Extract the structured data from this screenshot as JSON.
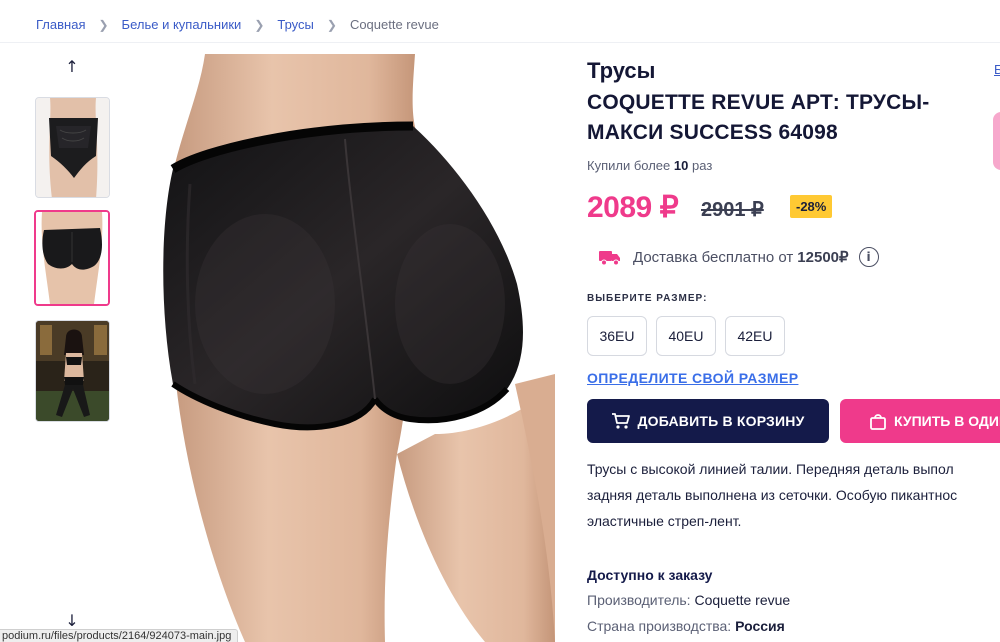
{
  "breadcrumb": {
    "items": [
      "Главная",
      "Белье и купальники",
      "Трусы"
    ],
    "current": "Coquette revue"
  },
  "product": {
    "title_line1": "Трусы",
    "title_line2": "COQUETTE REVUE АРТ: ТРУСЫ-МАКСИ SUCCESS 64098",
    "bought_prefix": "Купили более",
    "bought_count": "10",
    "bought_suffix": "раз",
    "price": "2089 ₽",
    "old_price": "2901 ₽",
    "discount": "-28%"
  },
  "delivery": {
    "text": "Доставка бесплатно от",
    "threshold": "12500₽",
    "info_glyph": "i"
  },
  "sizes": {
    "label": "ВЫБЕРИТЕ РАЗМЕР:",
    "options": [
      "36EU",
      "40EU",
      "42EU"
    ],
    "link": "ОПРЕДЕЛИТЕ СВОЙ РАЗМЕР"
  },
  "actions": {
    "add_to_cart": "ДОБАВИТЬ В КОРЗИНУ",
    "buy_one_click": "КУПИТЬ В ОДИН"
  },
  "description": {
    "lines": [
      "Трусы с высокой линией талии. Передняя деталь выпол",
      "задняя деталь выполнена из сеточки. Особую пикантнос",
      "эластичные стреп-лент."
    ]
  },
  "availability": {
    "title": "Доступно к заказу",
    "manufacturer_label": "Производитель:",
    "manufacturer": "Coquette revue",
    "country_label": "Страна производства:",
    "country": "Россия"
  },
  "status_bar": "podium.ru/files/products/2164/924073-main.jpg",
  "colors": {
    "accent_pink": "#ef3a8b",
    "navy": "#141a4a",
    "link_blue": "#3a6ee8",
    "discount_yellow": "#ffc933"
  }
}
